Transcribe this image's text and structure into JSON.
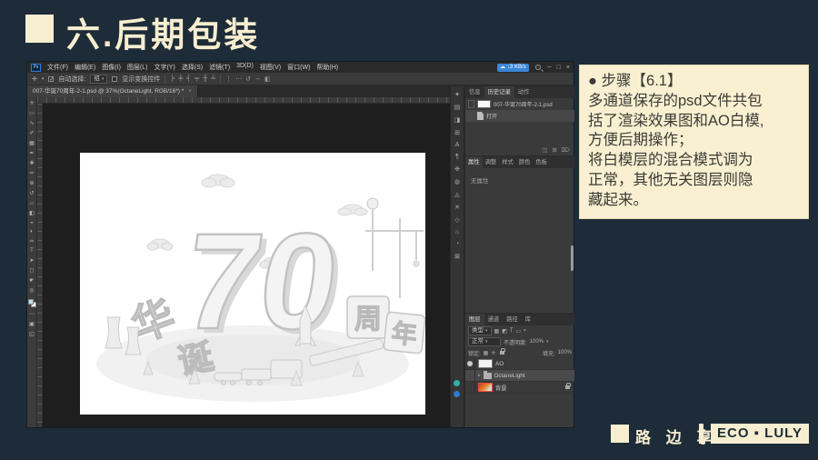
{
  "slide": {
    "title": "六.后期包装",
    "colors": {
      "background": "#1e2c39",
      "accent_cream": "#f7eed0",
      "note_bg": "#f9f0d2",
      "net_badge_blue": "#3b86d8",
      "selected_layer": "#4a4a4a",
      "bg_thumb_border_red": "#e74c3c"
    }
  },
  "note": {
    "heading": "●  步骤【6.1】",
    "body": "多通道保存的psd文件共包\n括了渲染效果图和AO白模,\n方便后期操作；\n将白模层的混合模式调为\n正常，其他无关图层则隐\n藏起来。"
  },
  "footer": {
    "brand": "路 边 享",
    "badge": "ECO ▪ LULY"
  },
  "ps": {
    "logo": "Ps",
    "menu": [
      "文件(F)",
      "编辑(E)",
      "图像(I)",
      "图层(L)",
      "文字(Y)",
      "选择(S)",
      "滤镜(T)",
      "3D(D)",
      "视图(V)",
      "窗口(W)",
      "帮助(H)"
    ],
    "net_badge_icon": "☁",
    "net_badge_text": "↓3 KB/s",
    "window_controls": [
      {
        "name": "minimize-icon",
        "glyph": "─"
      },
      {
        "name": "maximize-icon",
        "glyph": "□"
      },
      {
        "name": "close-icon",
        "glyph": "×"
      }
    ],
    "options": {
      "move_icon": "✛",
      "caret": "▾",
      "auto_select_label": "自动选择:",
      "auto_select_value": "组",
      "show_transform_label": "显示变换控件",
      "align_icons": [
        {
          "name": "align-left-icon",
          "glyph": "╞"
        },
        {
          "name": "align-center-h-icon",
          "glyph": "╪"
        },
        {
          "name": "align-right-icon",
          "glyph": "╡"
        },
        {
          "name": "align-top-icon",
          "glyph": "╤"
        },
        {
          "name": "align-middle-icon",
          "glyph": "╫"
        },
        {
          "name": "align-bottom-icon",
          "glyph": "╧"
        }
      ],
      "extra_icons": [
        {
          "name": "distribute-icon",
          "glyph": "⋮"
        },
        {
          "name": "distribute-h-icon",
          "glyph": "⋯"
        },
        {
          "name": "rotate-view-icon",
          "glyph": "↺"
        },
        {
          "name": "pan-axis-icon",
          "glyph": "↔"
        },
        {
          "name": "3d-mode-icon",
          "glyph": "◧"
        }
      ]
    },
    "doc_tab": {
      "title": "007-华诞70周年-2-1.psd @ 37%(OctaneLight, RGB/16*) *",
      "close": "×"
    },
    "tools": [
      {
        "name": "move-tool-icon",
        "glyph": "✛"
      },
      {
        "name": "marquee-tool-icon",
        "glyph": "▭"
      },
      {
        "name": "lasso-tool-icon",
        "glyph": "∿"
      },
      {
        "name": "quick-select-tool-icon",
        "glyph": "✐"
      },
      {
        "name": "crop-tool-icon",
        "glyph": "▦"
      },
      {
        "name": "eyedropper-tool-icon",
        "glyph": "✒"
      },
      {
        "name": "healing-tool-icon",
        "glyph": "✚"
      },
      {
        "name": "brush-tool-icon",
        "glyph": "✏"
      },
      {
        "name": "clone-stamp-tool-icon",
        "glyph": "⊕"
      },
      {
        "name": "history-brush-tool-icon",
        "glyph": "↺"
      },
      {
        "name": "eraser-tool-icon",
        "glyph": "▱"
      },
      {
        "name": "gradient-tool-icon",
        "glyph": "◧"
      },
      {
        "name": "blur-tool-icon",
        "glyph": "◒"
      },
      {
        "name": "dodge-tool-icon",
        "glyph": "◐"
      },
      {
        "name": "pen-tool-icon",
        "glyph": "✑"
      },
      {
        "name": "type-tool-icon",
        "glyph": "T"
      },
      {
        "name": "path-select-tool-icon",
        "glyph": "➤"
      },
      {
        "name": "shape-tool-icon",
        "glyph": "◻"
      },
      {
        "name": "hand-tool-icon",
        "glyph": "☛"
      },
      {
        "name": "zoom-tool-icon",
        "glyph": "◎"
      }
    ],
    "tools_bottom": [
      {
        "name": "edit-toolbar-icon",
        "glyph": "⋯"
      },
      {
        "name": "quick-mask-icon",
        "glyph": "▣"
      },
      {
        "name": "screen-mode-icon",
        "glyph": "◱"
      }
    ],
    "collapsed_icons": [
      {
        "name": "color-panel-icon",
        "glyph": "✦"
      },
      {
        "name": "swatches-panel-icon",
        "glyph": "▤"
      },
      {
        "name": "gradients-panel-icon",
        "glyph": "◨"
      },
      {
        "name": "patterns-panel-icon",
        "glyph": "⊞"
      },
      {
        "name": "character-panel-icon",
        "glyph": "A"
      },
      {
        "name": "paragraph-panel-icon",
        "glyph": "¶"
      },
      {
        "name": "brush-settings-panel-icon",
        "glyph": "❉"
      },
      {
        "name": "clone-source-panel-icon",
        "glyph": "◍"
      },
      {
        "name": "adjustments-panel-icon",
        "glyph": "◬"
      },
      {
        "name": "styles-panel-icon",
        "glyph": "✕"
      },
      {
        "name": "shapes-panel-icon",
        "glyph": "◇"
      },
      {
        "name": "navigator-panel-icon",
        "glyph": "⌂"
      },
      {
        "name": "timeline-panel-icon",
        "glyph": "◔"
      },
      {
        "name": "info-panel-icon",
        "glyph": "⊠"
      }
    ],
    "panels": {
      "history": {
        "tabs": [
          "信息",
          "历史记录",
          "动作"
        ],
        "snapshot_name": "007-华诞70周年-2-1.psd",
        "state_open": "打开",
        "footer_icons": [
          {
            "name": "new-document-from-state-icon",
            "glyph": "◫"
          },
          {
            "name": "new-snapshot-icon",
            "glyph": "⊞"
          },
          {
            "name": "delete-state-icon",
            "glyph": "⌦"
          }
        ]
      },
      "properties": {
        "tabs": [
          "属性",
          "调整",
          "样式",
          "颜色",
          "色板"
        ],
        "empty_text": "无属性"
      },
      "layers": {
        "tabs": [
          "图层",
          "通道",
          "路径",
          "库"
        ],
        "filter_label": "类型",
        "filter_icons": [
          {
            "name": "filter-pixel-icon",
            "glyph": "▦"
          },
          {
            "name": "filter-adjustment-icon",
            "glyph": "◩"
          },
          {
            "name": "filter-type-icon",
            "glyph": "T"
          },
          {
            "name": "filter-shape-icon",
            "glyph": "▭"
          },
          {
            "name": "filter-smart-icon",
            "glyph": "▪"
          }
        ],
        "blend_mode": "正常",
        "opacity_label": "不透明度:",
        "opacity_value": "100%",
        "lock_label": "锁定:",
        "fill_label": "填充:",
        "fill_value": "100%",
        "items": [
          {
            "name": "AO"
          },
          {
            "name": "OctaneLight"
          },
          {
            "name": "背景"
          }
        ]
      }
    },
    "artwork": {
      "number": "70",
      "left_char_1": "华",
      "left_char_2": "诞",
      "right_char_1": "周",
      "right_char_2": "年"
    }
  }
}
